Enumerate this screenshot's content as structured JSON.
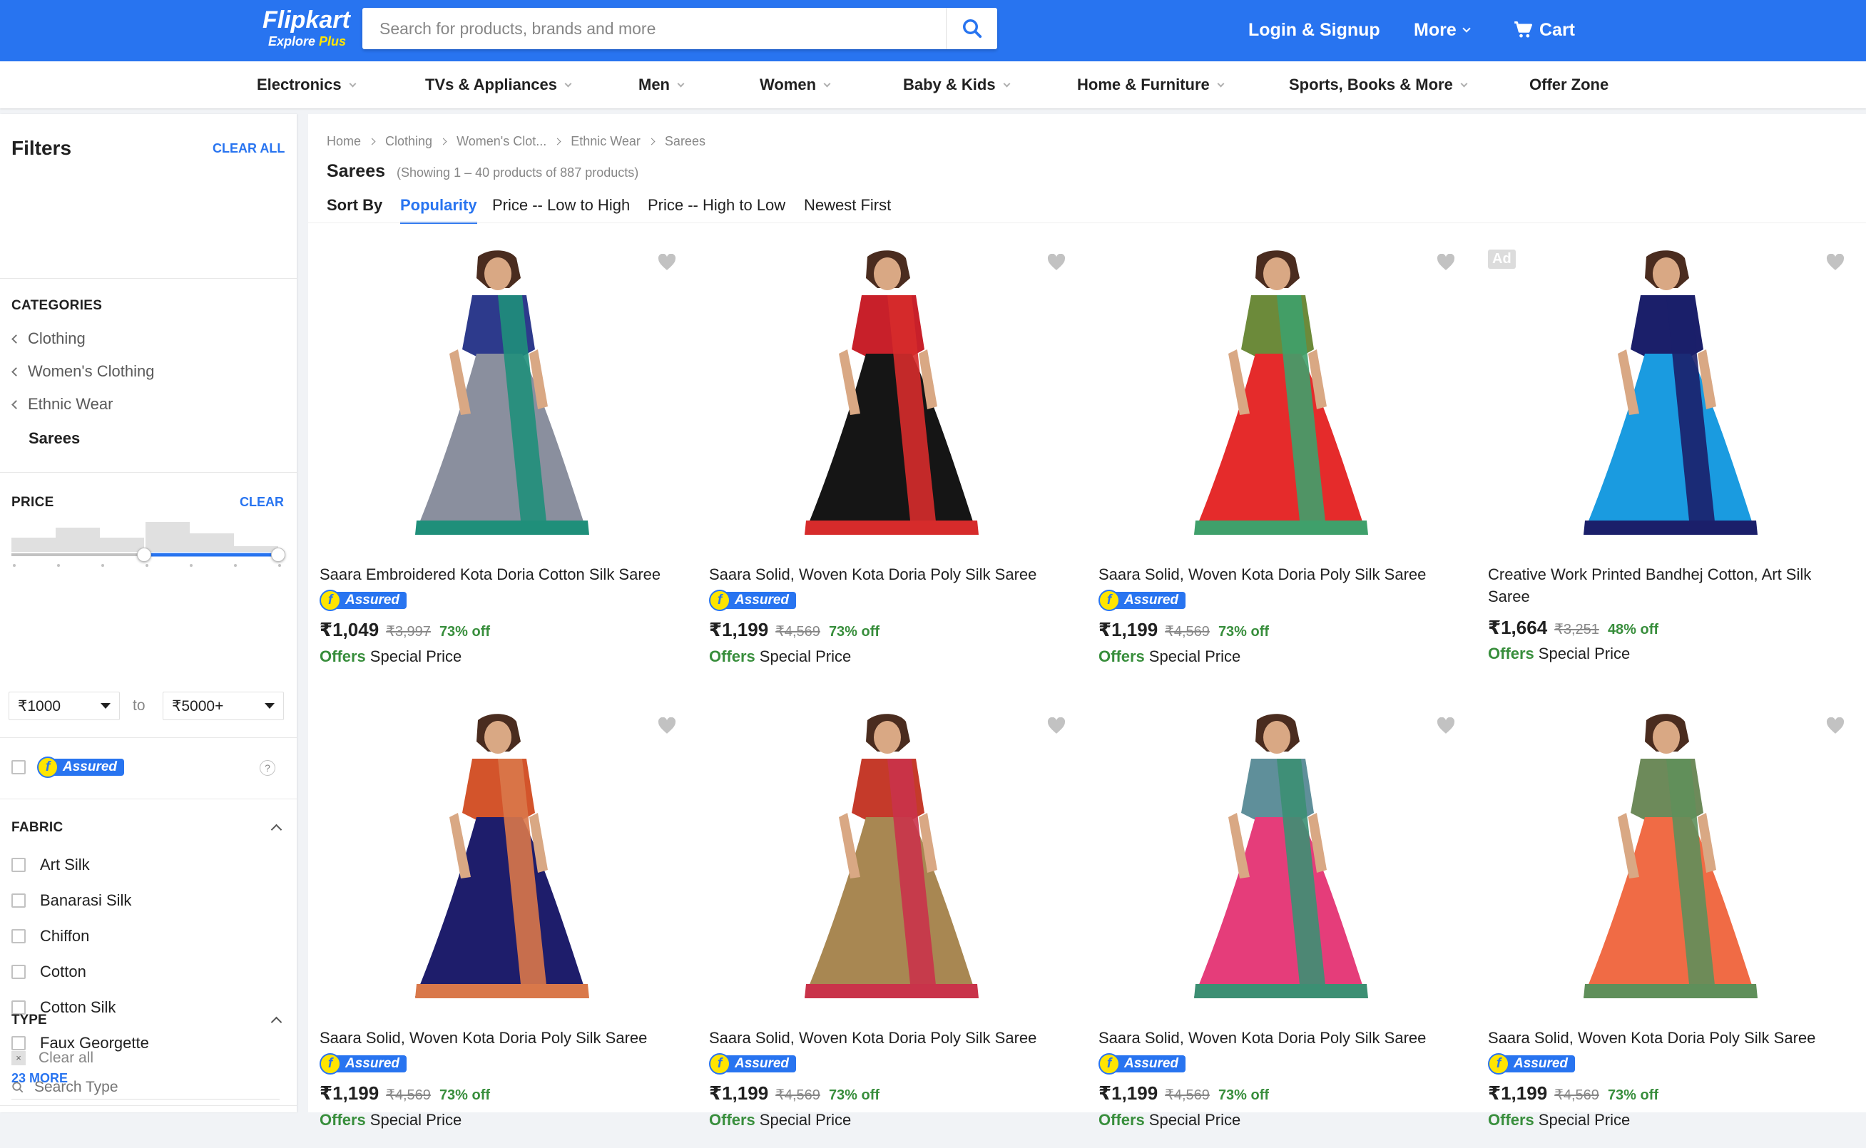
{
  "header": {
    "logo": "Flipkart",
    "logo_sub": "Explore",
    "logo_plus": "Plus",
    "search_placeholder": "Search for products, brands and more",
    "login": "Login & Signup",
    "more": "More",
    "cart": "Cart"
  },
  "nav": [
    "Electronics",
    "TVs & Appliances",
    "Men",
    "Women",
    "Baby & Kids",
    "Home & Furniture",
    "Sports, Books & More",
    "Offer Zone"
  ],
  "filters": {
    "title": "Filters",
    "clear_all": "CLEAR ALL",
    "categories_heading": "CATEGORIES",
    "categories": [
      "Clothing",
      "Women's Clothing",
      "Ethnic Wear"
    ],
    "current_category": "Sarees",
    "price_heading": "PRICE",
    "price_clear": "CLEAR",
    "price_min": "₹1000",
    "price_to": "to",
    "price_max": "₹5000+",
    "assured_label": "Assured",
    "help": "?",
    "fabric_heading": "FABRIC",
    "fabrics": [
      "Art Silk",
      "Banarasi Silk",
      "Chiffon",
      "Cotton",
      "Cotton Silk",
      "Faux Georgette"
    ],
    "more_fabrics": "23 MORE",
    "type_heading": "TYPE",
    "type_clear": "Clear all",
    "type_search_placeholder": "Search Type"
  },
  "breadcrumbs": [
    "Home",
    "Clothing",
    "Women's Clot...",
    "Ethnic Wear",
    "Sarees"
  ],
  "results": {
    "title": "Sarees",
    "count": "(Showing 1 – 40 products of 887 products)"
  },
  "sort": {
    "label": "Sort By",
    "options": [
      "Popularity",
      "Price -- Low to High",
      "Price -- High to Low",
      "Newest First"
    ],
    "active": "Popularity"
  },
  "products": [
    {
      "title": "Saara Embroidered Kota Doria Cotton Silk Saree",
      "assured": true,
      "price": "₹1,049",
      "mrp": "₹3,997",
      "off": "73% off",
      "offers_label": "Offers",
      "offers_text": "Special Price",
      "ad": false,
      "colors": {
        "saree": "#8a8f9e",
        "border": "#1f8f7a",
        "blouse": "#2d3a8c"
      }
    },
    {
      "title": "Saara Solid, Woven Kota Doria Poly Silk Saree",
      "assured": true,
      "price": "₹1,199",
      "mrp": "₹4,569",
      "off": "73% off",
      "offers_label": "Offers",
      "offers_text": "Special Price",
      "ad": false,
      "colors": {
        "saree": "#151515",
        "border": "#d62b2b",
        "blouse": "#c8202a"
      }
    },
    {
      "title": "Saara Solid, Woven Kota Doria Poly Silk Saree",
      "assured": true,
      "price": "₹1,199",
      "mrp": "₹4,569",
      "off": "73% off",
      "offers_label": "Offers",
      "offers_text": "Special Price",
      "ad": false,
      "colors": {
        "saree": "#e52b2b",
        "border": "#3fa06b",
        "blouse": "#6c8a3a"
      }
    },
    {
      "title": "Creative Work Printed Bandhej Cotton, Art Silk Saree",
      "assured": false,
      "price": "₹1,664",
      "mrp": "₹3,251",
      "off": "48% off",
      "offers_label": "Offers",
      "offers_text": "Special Price",
      "ad": true,
      "ad_label": "Ad",
      "colors": {
        "saree": "#1a9be0",
        "border": "#1b1f6a",
        "blouse": "#1b1f6a"
      }
    },
    {
      "title": "Saara Solid, Woven Kota Doria Poly Silk Saree",
      "assured": true,
      "price": "₹1,199",
      "mrp": "₹4,569",
      "off": "73% off",
      "offers_label": "Offers",
      "offers_text": "Special Price",
      "ad": false,
      "colors": {
        "saree": "#1e1d6b",
        "border": "#d9784a",
        "blouse": "#d3542b"
      }
    },
    {
      "title": "Saara Solid, Woven Kota Doria Poly Silk Saree",
      "assured": true,
      "price": "₹1,199",
      "mrp": "₹4,569",
      "off": "73% off",
      "offers_label": "Offers",
      "offers_text": "Special Price",
      "ad": false,
      "colors": {
        "saree": "#a88752",
        "border": "#c9334a",
        "blouse": "#c53a2a"
      }
    },
    {
      "title": "Saara Solid, Woven Kota Doria Poly Silk Saree",
      "assured": true,
      "price": "₹1,199",
      "mrp": "₹4,569",
      "off": "73% off",
      "offers_label": "Offers",
      "offers_text": "Special Price",
      "ad": false,
      "colors": {
        "saree": "#e53d7a",
        "border": "#3c8f73",
        "blouse": "#5f8f9a"
      }
    },
    {
      "title": "Saara Solid, Woven Kota Doria Poly Silk Saree",
      "assured": true,
      "price": "₹1,199",
      "mrp": "₹4,569",
      "off": "73% off",
      "offers_label": "Offers",
      "offers_text": "Special Price",
      "ad": false,
      "colors": {
        "saree": "#f06b45",
        "border": "#5f8f5a",
        "blouse": "#6d8a5a"
      }
    }
  ]
}
